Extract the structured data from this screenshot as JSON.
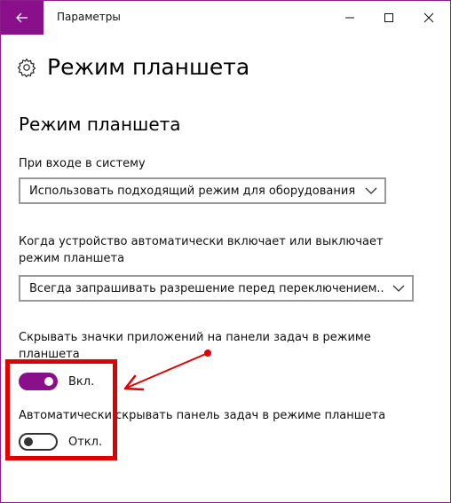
{
  "window": {
    "title": "Параметры"
  },
  "page": {
    "title": "Режим планшета",
    "section_title": "Режим планшета"
  },
  "signin": {
    "label": "При входе в систему",
    "value": "Использовать подходящий режим для оборудования"
  },
  "auto_switch": {
    "label_line1": "Когда устройство автоматически включает или выключает",
    "label_line2": "режим планшета",
    "value": "Всегда запрашивать разрешение перед переключением..."
  },
  "hide_icons": {
    "label_line1": "Скрывать значки приложений на панели задач в режиме",
    "label_line2": "планшета",
    "state": "Вкл."
  },
  "auto_hide_taskbar": {
    "label": "Автоматически скрывать панель задач в режиме планшета",
    "state": "Откл."
  },
  "colors": {
    "accent": "#8a0f8a",
    "annotation": "#e00000"
  },
  "icons": {
    "back": "arrow-left-icon",
    "settings": "gear-icon",
    "minimize": "minimize-icon",
    "maximize": "maximize-icon",
    "close": "close-icon",
    "dropdown": "chevron-down-icon"
  }
}
